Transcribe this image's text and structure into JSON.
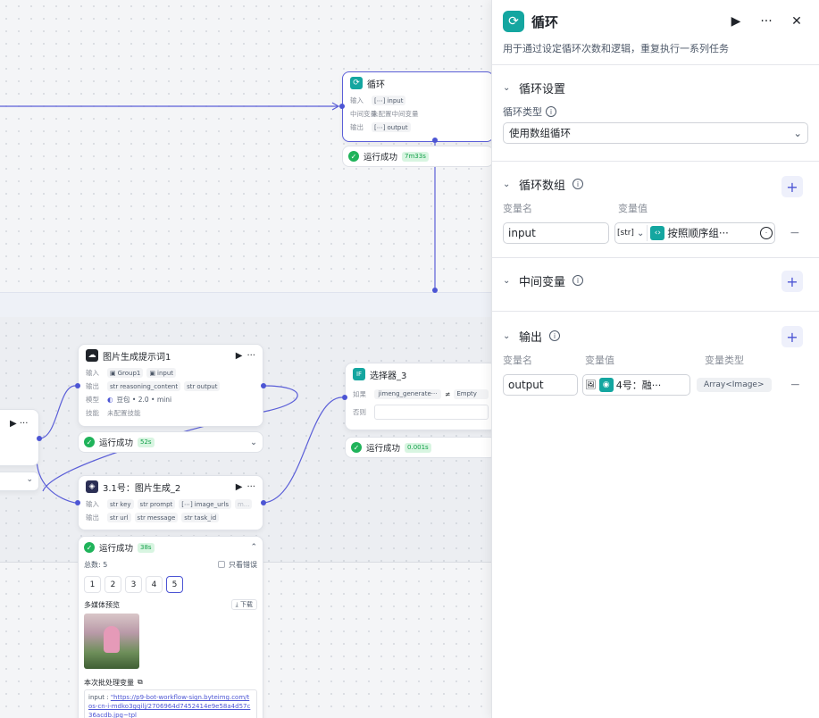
{
  "loop_node": {
    "title": "循环",
    "in_label": "输入",
    "in_tag": "input",
    "mid_label": "中间变量",
    "mid_value": "未配置中间变量",
    "out_label": "输出",
    "out_tag": "output",
    "status": "运行成功",
    "time": "7m33s"
  },
  "prompt_node": {
    "title": "图片生成提示词1",
    "in_label": "输入",
    "in_tags": [
      "Group1",
      "input"
    ],
    "out_label": "输出",
    "out_tags": [
      "reasoning_content",
      "output"
    ],
    "model_label": "模型",
    "model": "豆包 • 2.0 • mini",
    "skill_label": "技能",
    "skill": "未配置技能",
    "status": "运行成功",
    "time": "52s"
  },
  "selector_node": {
    "title": "选择器_3",
    "if_label": "如果",
    "cond_left": "jimeng_generate···",
    "cond_op": "≠",
    "cond_right": "Empty",
    "else_label": "否则",
    "status": "运行成功",
    "time": "0.001s"
  },
  "image_node": {
    "title": "3.1号：图片生成_2",
    "in_label": "输入",
    "in_tags": [
      "key",
      "prompt",
      "image_urls",
      "m..."
    ],
    "out_label": "输出",
    "out_tags": [
      "url",
      "message",
      "task_id"
    ],
    "status": "运行成功",
    "time": "38s",
    "total": "总数: 5",
    "only_errors": "只看错误",
    "pages": [
      "1",
      "2",
      "3",
      "4",
      "5"
    ],
    "media_preview": "多媒体预览",
    "download": "下载",
    "batch_vars": "本次批处理变量",
    "input_key": "input : ",
    "input_value": "\"https://p9-bot-workflow-sign.byteimg.com/tos-cn-i-mdko3gqilj/2706964d7452414e9e58a4d57c36acdb.jpg~tpl"
  },
  "panel": {
    "title": "循环",
    "description": "用于通过设定循环次数和逻辑，重复执行一系列任务",
    "loop_settings": "循环设置",
    "loop_type_label": "循环类型",
    "loop_type_value": "使用数组循环",
    "loop_array": "循环数组",
    "var_name_label": "变量名",
    "var_value_label": "变量值",
    "array_var_name": "input",
    "array_type": "[str]",
    "array_value": "按照顺序组···",
    "mid_vars": "中间变量",
    "output": "输出",
    "out_var_name_label": "变量名",
    "out_var_value_label": "变量值",
    "out_var_type_label": "变量类型",
    "out_var_name": "output",
    "out_value": "4号：融···",
    "out_type": "Array<Image>"
  },
  "colors": {
    "accent": "#4c55d4",
    "teal": "#14a6a0",
    "success": "#1fb35a"
  }
}
